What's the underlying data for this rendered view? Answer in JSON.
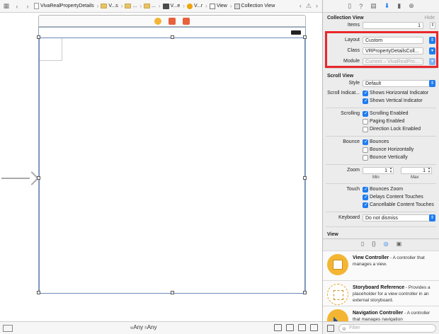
{
  "jumpbar": {
    "crumbs": [
      "VivaRealPropertyDetails",
      "V...s",
      "...",
      "...",
      "V...e",
      "V...r",
      "View",
      "Collection View"
    ]
  },
  "canvas": {
    "size_class": {
      "w_prefix": "w",
      "w_value": "Any",
      "h_prefix": "h",
      "h_value": "Any"
    }
  },
  "inspector": {
    "collection_view": {
      "title": "Collection View",
      "hide_label": "Hide",
      "items_label": "Items",
      "items_value": "1",
      "layout_label": "Layout",
      "layout_value": "Custom",
      "class_label": "Class",
      "class_value": "VRPropertyDetailsColl...",
      "module_label": "Module",
      "module_value": "Current – VivaRealPro..."
    },
    "scroll_view": {
      "title": "Scroll View",
      "style_label": "Style",
      "style_value": "Default",
      "indicators_label": "Scroll Indicat...",
      "show_horizontal": "Shows Horizontal Indicator",
      "show_vertical": "Shows Vertical Indicator",
      "scrolling_label": "Scrolling",
      "scrolling_enabled": "Scrolling Enabled",
      "paging_enabled": "Paging Enabled",
      "direction_lock": "Direction Lock Enabled",
      "bounce_label": "Bounce",
      "bounces": "Bounces",
      "bounce_horizontally": "Bounce Horizontally",
      "bounce_vertically": "Bounce Vertically",
      "zoom_label": "Zoom",
      "zoom_min_value": "1",
      "zoom_max_value": "1",
      "zoom_min_caption": "Min",
      "zoom_max_caption": "Max",
      "touch_label": "Touch",
      "bounces_zoom": "Bounces Zoom",
      "delays_touches": "Delays Content Touches",
      "cancellable_touches": "Cancellable Content Touches",
      "keyboard_label": "Keyboard",
      "keyboard_value": "Do not dismiss"
    },
    "view": {
      "title": "View"
    }
  },
  "library": {
    "items": [
      {
        "title": "View Controller",
        "desc": " - A controller that manages a view."
      },
      {
        "title": "Storyboard Reference",
        "desc": " - Provides a placeholder for a view controller in an external storyboard."
      },
      {
        "title": "Navigation Controller",
        "desc": " - A controller that manages navigation"
      }
    ],
    "filter_placeholder": "Filter"
  }
}
